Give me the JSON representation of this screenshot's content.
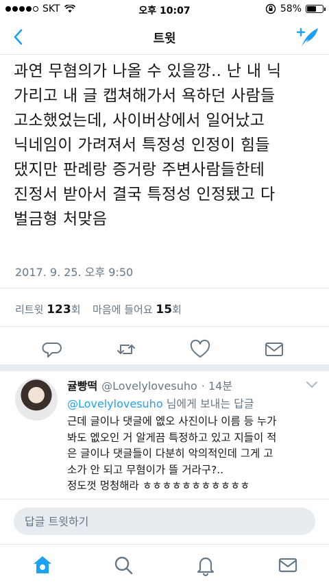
{
  "status_bar": {
    "carrier": "SKT",
    "time": "오후 10:07",
    "battery": "58%",
    "battery_level": 0.58
  },
  "nav": {
    "title": "트윗",
    "back_icon": "chevron-left-icon",
    "compose_icon": "compose-tweet-icon"
  },
  "tweet": {
    "text": "과연 무혐의가 나올 수 있을깡.. 난 내 닉\n가리고 내 글 캡쳐해가서 욕하던 사람들\n고소했었는데, 사이버상에서 일어났고\n닉네임이 가려져서 특정성 인정이 힘들\n댔지만 판례랑 증거랑 주변사람들한테\n진정서 받아서 결국 특정성 인정됐고 다\n벌금형 처맞음",
    "timestamp": "2017. 9. 25. 오후 9:50",
    "retweet_label": "리트윗",
    "retweet_count": "123",
    "retweet_unit": "회",
    "like_label": "마음에 들어요",
    "like_count": "15",
    "like_unit": "회"
  },
  "actions": [
    "reply-icon",
    "retweet-icon",
    "like-icon",
    "message-icon"
  ],
  "reply": {
    "name": "귤빵떡",
    "handle": "@Lovelylovesuho",
    "time": "· 14분",
    "reply_to_mention": "@Lovelylovesuho",
    "reply_to_suffix": " 님에게 보내는 답글",
    "text": "근데 글이나 댓글에 엢오 사진이나 이름 등 누가\n봐도 엢오인 거 알게끔 특정하고 있고 지들이 적\n은 글이나 댓글들이 다분히 악의적인데 그게 고\n소가 안 되고 무혐이가 뜰 거라구?..\n정도껏 멍청해라 ㅎㅎㅎㅎㅎㅎㅎㅎㅎㅎㅎ"
  },
  "composer": {
    "placeholder": "답글 트윗하기"
  },
  "tabs": [
    "home-icon",
    "search-icon",
    "notifications-icon",
    "messages-icon"
  ],
  "colors": {
    "accent": "#1da1f2",
    "text": "#14171a",
    "secondary": "#657786",
    "divider": "#e1e8ed"
  }
}
